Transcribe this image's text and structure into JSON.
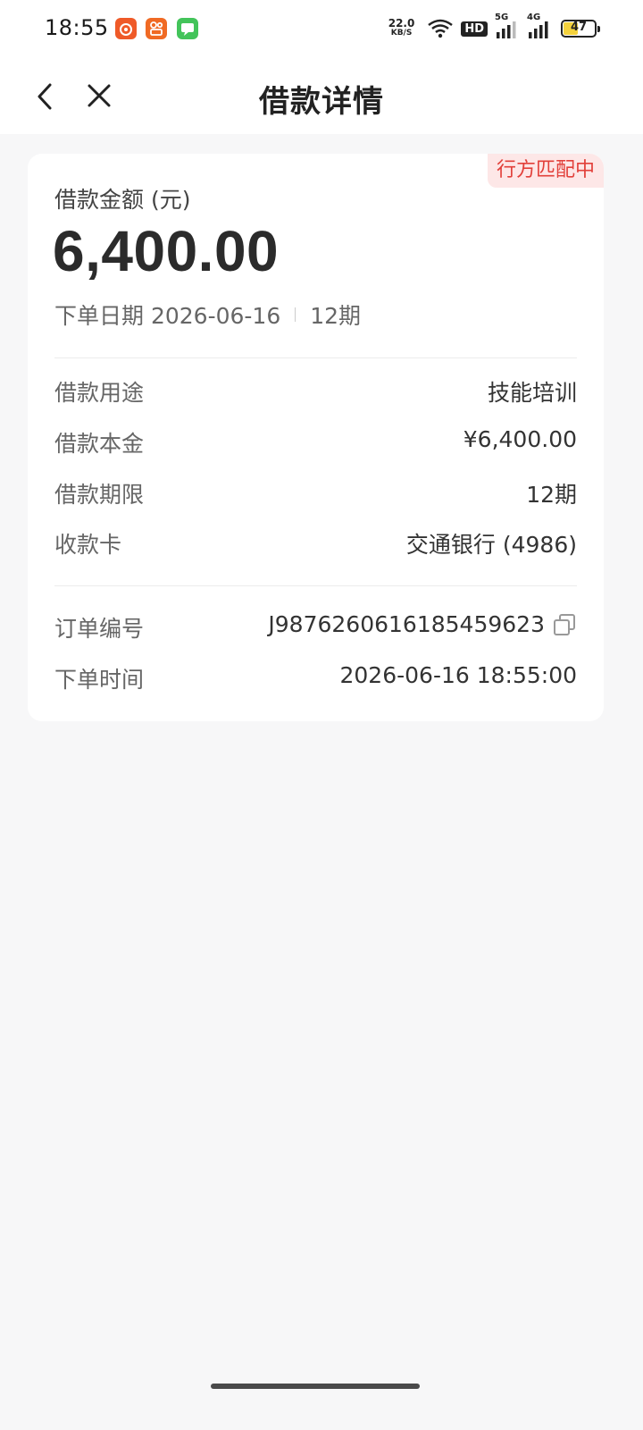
{
  "status_bar": {
    "time": "18:55",
    "net_speed_value": "22.0",
    "net_speed_unit": "KB/S",
    "hd_label": "HD",
    "signal1_label": "5G",
    "signal2_label": "4G",
    "battery_level": "47",
    "app_icons": [
      "weibo-style-icon",
      "video-app-icon",
      "messages-icon"
    ],
    "colors": {
      "app1": "#ef5a28",
      "app2": "#f06a24",
      "app3": "#43c45a"
    }
  },
  "nav": {
    "title": "借款详情",
    "back_icon": "chevron-left-icon",
    "close_icon": "close-icon"
  },
  "card": {
    "status_tag": "行方匹配中",
    "amount_label": "借款金额 (元)",
    "amount_value": "6,400.00",
    "order_date_label": "下单日期 2026-06-16",
    "term_short": "12期",
    "details": [
      {
        "label": "借款用途",
        "value": "技能培训"
      },
      {
        "label": "借款本金",
        "value": "¥6,400.00"
      },
      {
        "label": "借款期限",
        "value": "12期"
      },
      {
        "label": "收款卡",
        "value": "交通银行 (4986)"
      }
    ],
    "order": [
      {
        "label": "订单编号",
        "value": "J9876260616185459623"
      },
      {
        "label": "下单时间",
        "value": "2026-06-16 18:55:00"
      }
    ]
  },
  "colors": {
    "tag_bg": "#fde7e7",
    "tag_text": "#e2403a",
    "page_bg": "#f7f7f8"
  }
}
